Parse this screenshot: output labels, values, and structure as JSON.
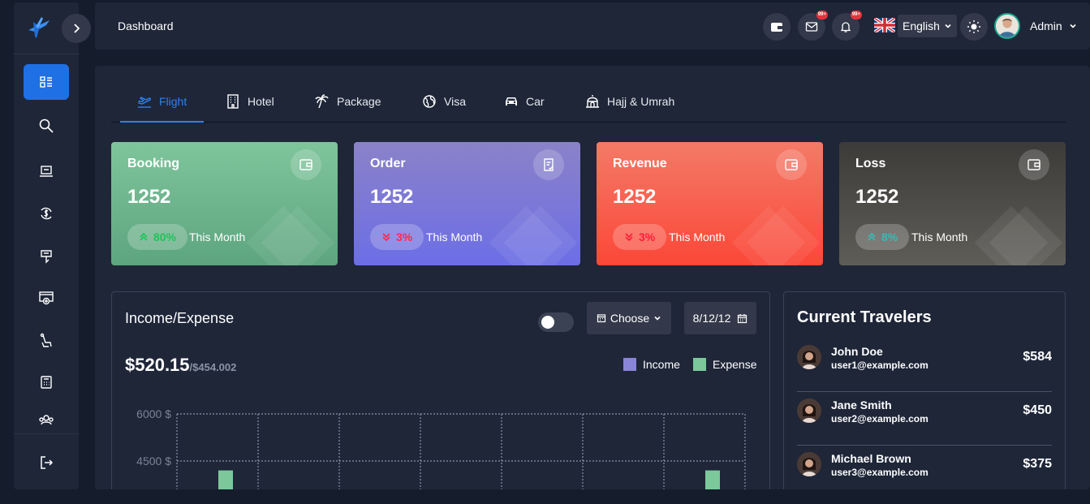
{
  "header": {
    "title": "Dashboard",
    "wallet_icon": "wallet-icon",
    "mail_badge": "99+",
    "notif_badge": "99+",
    "language": "English",
    "user": "Admin"
  },
  "sidebar": {
    "items": [
      {
        "name": "dashboard",
        "icon": "dashboard-icon"
      },
      {
        "name": "search",
        "icon": "search-icon"
      },
      {
        "name": "booking",
        "icon": "laptop-icon"
      },
      {
        "name": "refund",
        "icon": "currency-exchange-icon"
      },
      {
        "name": "deals",
        "icon": "ticket-icon"
      },
      {
        "name": "payments",
        "icon": "monitor-add-icon"
      },
      {
        "name": "seat",
        "icon": "seat-icon"
      },
      {
        "name": "reports",
        "icon": "calculator-icon"
      },
      {
        "name": "support",
        "icon": "group-icon"
      }
    ],
    "logout_icon": "logout-icon"
  },
  "tabs": [
    {
      "label": "Flight",
      "icon": "airplane-icon",
      "active": true
    },
    {
      "label": "Hotel",
      "icon": "building-icon"
    },
    {
      "label": "Package",
      "icon": "palm-tree-icon"
    },
    {
      "label": "Visa",
      "icon": "globe-icon"
    },
    {
      "label": "Car",
      "icon": "car-icon"
    },
    {
      "label": "Hajj & Umrah",
      "icon": "mosque-icon"
    }
  ],
  "cards": [
    {
      "title": "Booking",
      "value": "1252",
      "change": "80%",
      "direction": "up",
      "period": "This Month",
      "color_from": "#7fc59c",
      "color_to": "#5da57f",
      "change_color": "#1fc45a"
    },
    {
      "title": "Order",
      "value": "1252",
      "change": "3%",
      "direction": "down",
      "period": "This Month",
      "color_from": "#8b82c8",
      "color_to": "#6c6ee6",
      "change_color": "#ff2a4d"
    },
    {
      "title": "Revenue",
      "value": "1252",
      "change": "3%",
      "direction": "down",
      "period": "This Month",
      "color_from": "#f47a67",
      "color_to": "#fb4738",
      "change_color": "#ff1f3a"
    },
    {
      "title": "Loss",
      "value": "1252",
      "change": "8%",
      "direction": "up",
      "period": "This Month",
      "color_from": "#3d3b39",
      "color_to": "#5f5d58",
      "change_color": "#3bb8b5"
    }
  ],
  "income_expense": {
    "title": "Income/Expense",
    "choose_label": "Choose",
    "date": "8/12/12",
    "total": "$520.15",
    "total_sub": "/$454.002",
    "legend": [
      {
        "label": "Income",
        "color": "#8b85d9"
      },
      {
        "label": "Expense",
        "color": "#7cc89a"
      }
    ]
  },
  "chart_data": {
    "type": "bar",
    "y_ticks": [
      "6000 $",
      "4500 $"
    ],
    "ylim_visible": [
      4500,
      6000
    ],
    "series": [
      {
        "name": "Expense",
        "values": [
          4200,
          4200
        ]
      }
    ],
    "bar_slots": [
      1,
      7
    ],
    "grid": true
  },
  "travelers": {
    "title": "Current Travelers",
    "rows": [
      {
        "name": "John Doe",
        "email": "user1@example.com",
        "amount": "$584"
      },
      {
        "name": "Jane Smith",
        "email": "user2@example.com",
        "amount": "$450"
      },
      {
        "name": "Michael Brown",
        "email": "user3@example.com",
        "amount": "$375"
      }
    ]
  }
}
